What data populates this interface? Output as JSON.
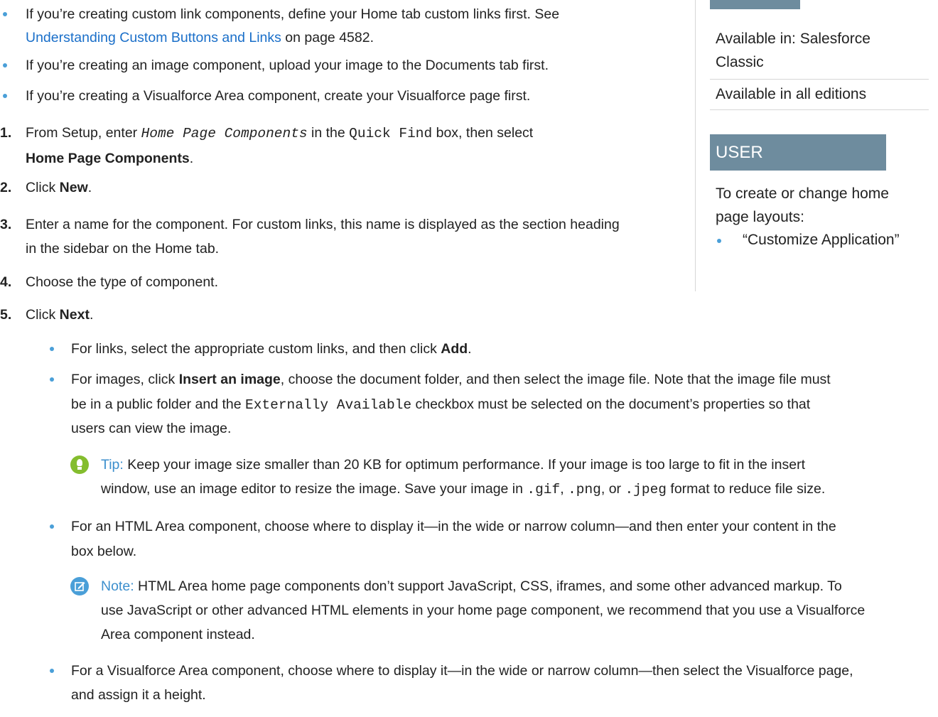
{
  "intro_bullets": [
    {
      "pre": "If you’re creating custom link components, define your Home tab custom links first. See",
      "link": "Understanding Custom Buttons and Links",
      "post": " on page 4582."
    },
    {
      "text": "If you’re creating an image component, upload your image to the Documents tab first."
    },
    {
      "text": "If you’re creating a Visualforce Area component, create your Visualforce page first."
    }
  ],
  "steps": [
    {
      "num": "1.",
      "pre": "From Setup, enter ",
      "code": "Home Page Components",
      "mid": " in the ",
      "code2": "Quick Find",
      "post": " box, then select",
      "bold_line": "Home Page Components",
      "end": "."
    },
    {
      "num": "2.",
      "pre": "Click ",
      "bold": "New",
      "post": "."
    },
    {
      "num": "3.",
      "line1": "Enter a name for the component. For custom links, this name is displayed as the section heading",
      "line2": "in the sidebar on the Home tab."
    },
    {
      "num": "4.",
      "text": "Choose the type of component."
    },
    {
      "num": "5.",
      "pre": "Click ",
      "bold": "Next",
      "post": "."
    }
  ],
  "sub_bullets": {
    "links": {
      "pre": "For links, select the appropriate custom links, and then click ",
      "bold": "Add",
      "post": "."
    },
    "images": {
      "pre": "For images, click ",
      "bold": "Insert an image",
      "post": ", choose the document folder, and then select the image file. Note that the image file must",
      "line2_pre": "be in a public folder and the ",
      "line2_code": "Externally Available",
      "line2_post": " checkbox must be selected on the document’s properties so that",
      "line3": "users can view the image."
    },
    "html_area": {
      "line1": "For an HTML Area component, choose where to display it—in the wide or narrow column—and then enter your content in the",
      "line2": "box below."
    },
    "vf_area": {
      "line1": "For a Visualforce Area component, choose where to display it—in the wide or narrow column—then select the Visualforce page,",
      "line2": "and assign it a height."
    }
  },
  "tip": {
    "label": "Tip:",
    "line1": " Keep your image size smaller than 20 KB for optimum performance. If your image is too large to fit in the insert",
    "line2_pre": "window, use an image editor to resize the image. Save your image in ",
    "code1": ".gif",
    "sep1": ", ",
    "code2": ".png",
    "sep2": ", or ",
    "code3": ".jpeg",
    "line2_post": " format to reduce file size."
  },
  "note": {
    "label": "Note:",
    "line1": " HTML Area home page components don’t support JavaScript, CSS, iframes, and some other advanced markup. To",
    "line2": "use JavaScript or other advanced HTML elements in your home page component, we recommend that you use a Visualforce",
    "line3": "Area component instead."
  },
  "sidebar": {
    "availability_line1": "Available in: Salesforce",
    "availability_line2": "Classic",
    "editions": "Available in all editions",
    "permissions_heading": "USER PERMISSIONS",
    "perm_desc_line1": "To create or change home",
    "perm_desc_line2": "page layouts:",
    "perm_item": "“Customize Application”"
  },
  "colors": {
    "bullet": "#4a9fd8",
    "link": "#1a6fc9",
    "sidebar_box": "#6e8c9e",
    "tip_icon": "#84bd2e",
    "note_icon": "#4a9fd8"
  }
}
